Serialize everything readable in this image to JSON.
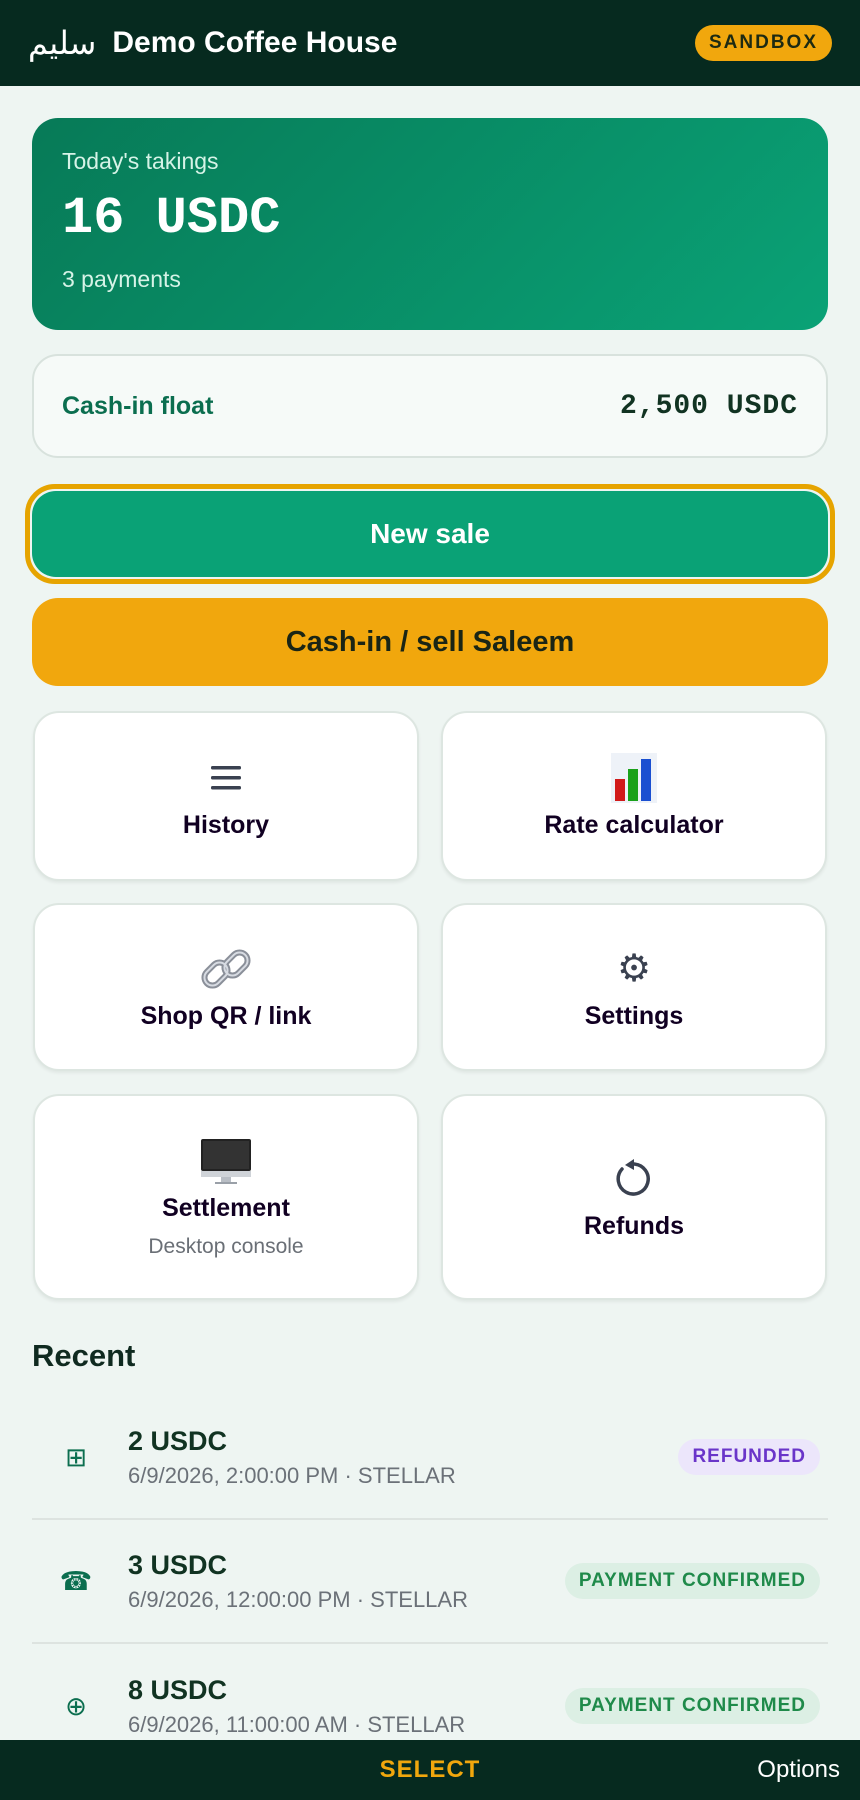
{
  "header": {
    "brand_arabic": "سليم",
    "brand_name": "Demo Coffee House",
    "badge": "SANDBOX"
  },
  "takings": {
    "label": "Today's takings",
    "amount": "16 USDC",
    "count": "3 payments"
  },
  "float": {
    "label": "Cash-in float",
    "value": "2,500 USDC"
  },
  "actions": {
    "new_sale": "New sale",
    "cashin": "Cash-in / sell Saleem"
  },
  "tiles": [
    {
      "label": "History",
      "icon": "list-icon"
    },
    {
      "label": "Rate calculator",
      "icon": "bar-chart-icon"
    },
    {
      "label": "Shop QR / link",
      "icon": "link-icon"
    },
    {
      "label": "Settings",
      "icon": "gear-icon"
    },
    {
      "label": "Settlement",
      "sub": "Desktop console",
      "icon": "desktop-icon"
    },
    {
      "label": "Refunds",
      "icon": "refund-icon"
    }
  ],
  "recent": {
    "title": "Recent",
    "items": [
      {
        "amount": "2 USDC",
        "meta": "6/9/2026, 2:00:00 PM · STELLAR",
        "status": "REFUNDED",
        "icon": "grid-icon"
      },
      {
        "amount": "3 USDC",
        "meta": "6/9/2026, 12:00:00 PM · STELLAR",
        "status": "PAYMENT CONFIRMED",
        "icon": "phone-icon"
      },
      {
        "amount": "8 USDC",
        "meta": "6/9/2026, 11:00:00 AM · STELLAR",
        "status": "PAYMENT CONFIRMED",
        "icon": "plus-circle-icon"
      }
    ]
  },
  "softkeys": {
    "center": "SELECT",
    "right": "Options"
  },
  "colors": {
    "primary": "#0aa276",
    "dark": "#062a1f",
    "accent": "#f1a70d"
  }
}
